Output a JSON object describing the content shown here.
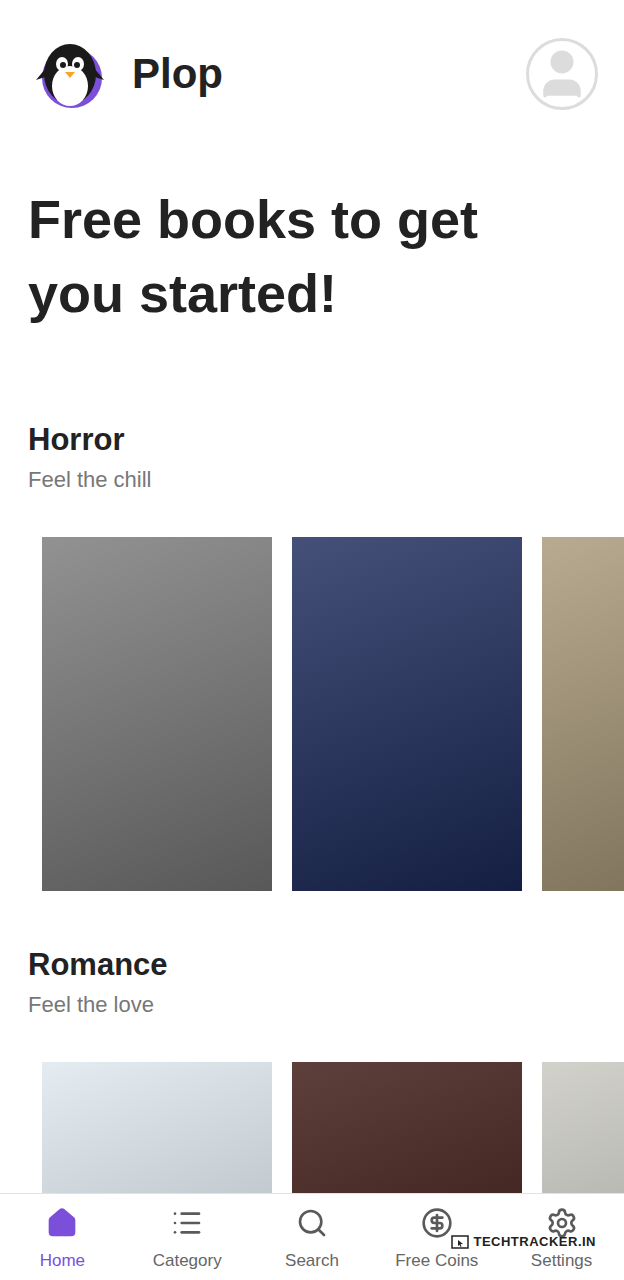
{
  "app": {
    "name": "Plop"
  },
  "headline": "Free books to get you started!",
  "sections": [
    {
      "title": "Horror",
      "subtitle": "Feel the chill",
      "books": [
        {
          "color": "#7a7a7a"
        },
        {
          "color": "#1c2a5c"
        },
        {
          "color": "#a89878"
        }
      ]
    },
    {
      "title": "Romance",
      "subtitle": "Feel the love",
      "books": [
        {
          "color": "#dfe8ee"
        },
        {
          "color": "#3a1510"
        },
        {
          "color": "#c8c8c0"
        }
      ]
    }
  ],
  "nav": [
    {
      "label": "Home",
      "selected": true
    },
    {
      "label": "Category",
      "selected": false
    },
    {
      "label": "Search",
      "selected": false
    },
    {
      "label": "Free Coins",
      "selected": false
    },
    {
      "label": "Settings",
      "selected": false
    }
  ],
  "watermark": "TECHTRACKER.IN"
}
